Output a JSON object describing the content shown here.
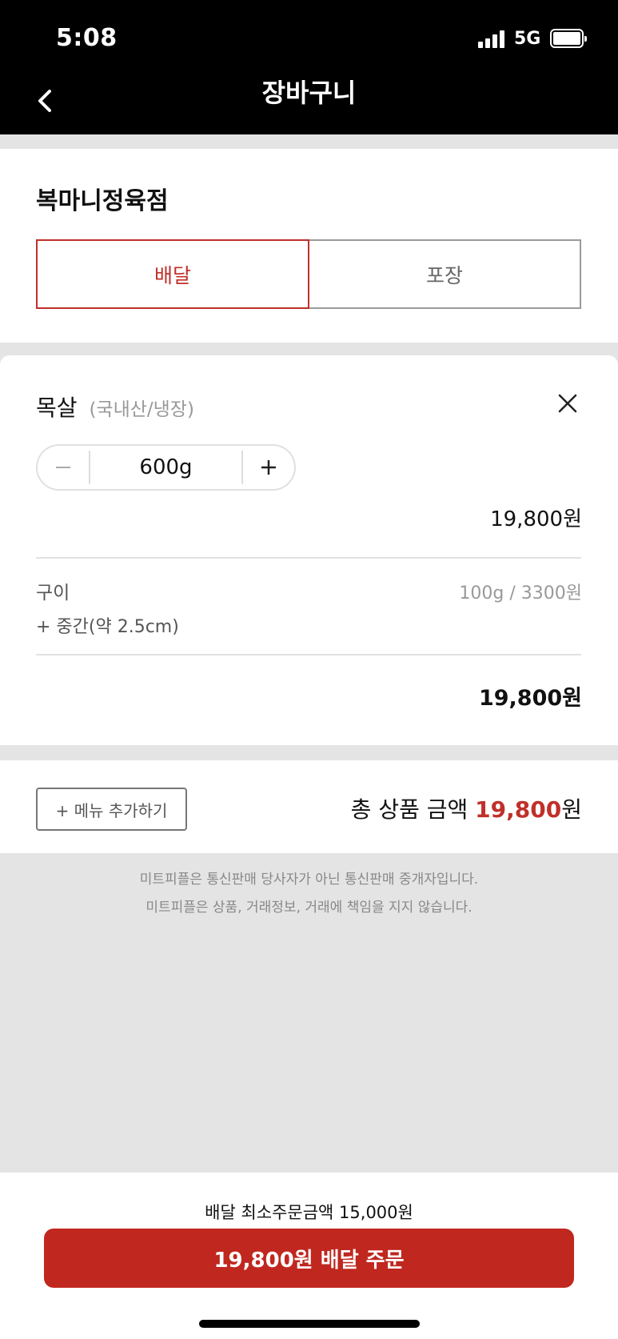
{
  "status": {
    "time": "5:08",
    "network": "5G"
  },
  "header": {
    "title": "장바구니"
  },
  "store": {
    "name": "복마니정육점",
    "tabs": [
      {
        "label": "배달"
      },
      {
        "label": "포장"
      }
    ]
  },
  "item": {
    "name": "목살",
    "origin": "(국내산/냉장)",
    "quantity": "600g",
    "price": "19,800원",
    "option_label": "구이",
    "option_unit_price": "100g / 3300원",
    "option_detail": "+ 중간(약 2.5cm)",
    "item_total": "19,800원"
  },
  "summary": {
    "add_menu_label": "+ 메뉴 추가하기",
    "total_label": "총 상품 금액",
    "total_amount": "19,800",
    "currency": "원"
  },
  "disclaimer": [
    "미트피플은 통신판매 당사자가 아닌 통신판매 중개자입니다.",
    "미트피플은 상품, 거래정보, 거래에 책임을 지지 않습니다."
  ],
  "footer": {
    "min_order": "배달 최소주문금액 15,000원",
    "order_button": "19,800원 배달 주문"
  },
  "colors": {
    "accent": "#c0271f",
    "header_bg": "#000000",
    "page_bg": "#e4e4e4"
  }
}
